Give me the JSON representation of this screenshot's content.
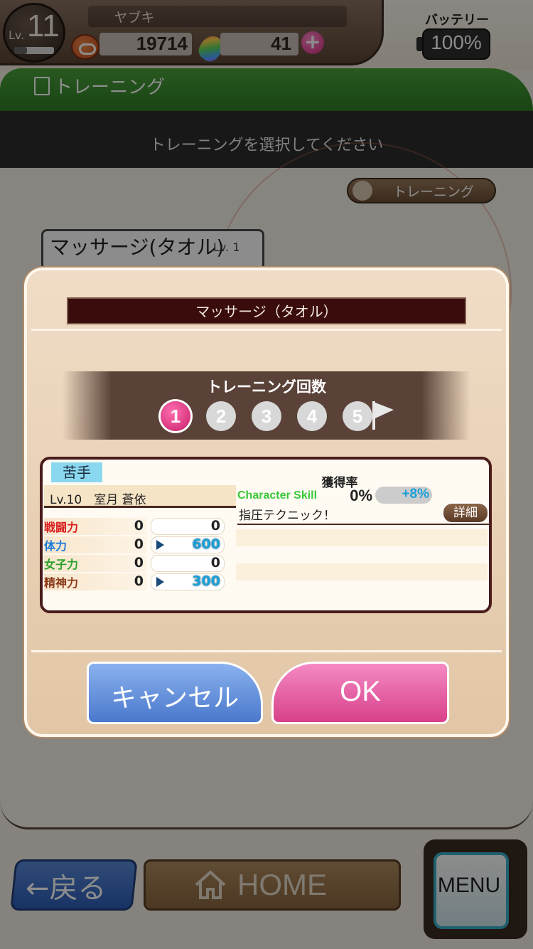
{
  "header": {
    "level_prefix": "Lv.",
    "level": "11",
    "player_name": "ヤブキ",
    "coins": "19714",
    "gems": "41",
    "plus": "+",
    "battery_label": "バッテリー",
    "battery_value": "100%"
  },
  "section": {
    "title": "トレーニング",
    "instruction": "トレーニングを選択してください",
    "tab_button": "トレーニング"
  },
  "background_list": {
    "card_title": "マッサージ(タオル)",
    "card_level": "Lv. 1"
  },
  "modal": {
    "title": "マッサージ（タオル）",
    "count_title": "トレーニング回数",
    "steps": [
      "1",
      "2",
      "3",
      "4",
      "5"
    ],
    "active_step": 1,
    "weak_badge": "苦手",
    "character": "Lv.10　室月 蒼依",
    "stats": [
      {
        "label": "戦闘力",
        "current": "0",
        "gain": "0",
        "color": "#d81e1e",
        "arrow": false
      },
      {
        "label": "体力",
        "current": "0",
        "gain": "600",
        "color": "#1a7ad8",
        "arrow": true
      },
      {
        "label": "女子力",
        "current": "0",
        "gain": "0",
        "color": "#2aa02a",
        "arrow": false
      },
      {
        "label": "精神力",
        "current": "0",
        "gain": "300",
        "color": "#8a3a1a",
        "arrow": true
      }
    ],
    "rate_label": "獲得率",
    "skill_label": "Character Skill",
    "rate_value": "0%",
    "rate_bonus": "+8%",
    "skill_name": "指圧テクニック！",
    "detail_button": "詳細",
    "cancel": "キャンセル",
    "ok": "OK"
  },
  "nav": {
    "back": "←戻る",
    "home": "HOME",
    "menu": "MENU"
  },
  "colors": {
    "section_green": "#2f7d26",
    "ok_pink": "#d8408a",
    "cancel_blue": "#4a78cc",
    "modal_bg": "#e2c6a6"
  }
}
